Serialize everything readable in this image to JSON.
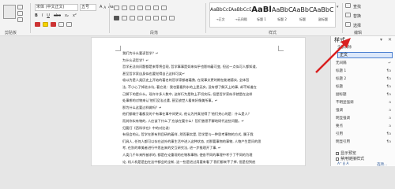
{
  "ribbon": {
    "clipboard": {
      "label": "剪贴板"
    },
    "font": {
      "name": "宋体 (中文正文)",
      "size": "五号",
      "grow": "A",
      "shrink": "A",
      "clear": "Aa",
      "style_buttons": [
        "B",
        "I",
        "U",
        "abc",
        "x₂",
        "x²"
      ]
    },
    "paragraph": {
      "label": "段落"
    },
    "styles": {
      "label": "样式",
      "gallery": [
        {
          "sample": "AaBbCcDc",
          "name": "→正文",
          "size": "small"
        },
        {
          "sample": "AaBbCcDc",
          "name": "→无间隔",
          "size": "small"
        },
        {
          "sample": "AaBl",
          "name": "标题 1",
          "size": "big"
        },
        {
          "sample": "AaBbC",
          "name": "标题 2",
          "size": "mid"
        },
        {
          "sample": "AaBbC",
          "name": "标题",
          "size": "mid"
        },
        {
          "sample": "AaBbC",
          "name": "副标题",
          "size": "mid"
        }
      ]
    },
    "editing": {
      "find": "查找",
      "replace": "替换",
      "select": "选择",
      "label": "编辑"
    }
  },
  "document": {
    "lines": [
      "我们为什么要读哲学？↵",
      "为什么读哲学？↵",
      "哲学无法向问题都是来等将会现, 哲学事事是如来似乎也影响着可变, 但这一点似可人都知道,",
      "甚至哲学家自身似也要觉得自己这样可笑↵",
      "吸以为是人类历史上开始的著名的哲学家都者着数, 在现事文更时期在能诸德实, 全体哲",
      "法, 不小心了掉进水坑, 著它说：我也要看到水的上是无实, 没有想了解天上的事, 却不知道在",
      "己脚下的是什么。现许许多人数中, 这样行为是称上不切实际, 但是哲学家似乎就是在这样",
      "处事哪的对物来认'他们没法过遇, 甚至放世人看来好像美所事。↵",
      "那为什么这要过样做吗？↵",
      "他们都做于着都见的个有事在事中间更义, 他认为并真觉得了'他们关心的是：什么是人？",
      "而其你实有物的, 人应该下什么了'应该在要什么！哲们曾思不解地研代这些问题。↵",
      "归要打《西科学在》中的对比说：",
      "有但会的认, 哲学在那有到目研的着样, 然而事实是, 哲学是与一种思考事物的方式, 属于我",
      "们具人, 任何人都可以存在这外的事生活中进入这种状态, 对那要事物的事物, 人物产生是问的思",
      "考, 在别的审美者进行中思出来的交互研究法, 进一步推理开了事, ↵",
      "人类几千年来所被求的, 都是在论重现的在物和事物, 使各不同的事理中考于了不同的为理",
      "论, 机人机是是由在这中都会的全新, 这一些是进过用要来看了'我们都来不了掉, 但是但到底"
    ]
  },
  "styles_pane": {
    "title": "样式",
    "select_all": "全部清除",
    "items": [
      {
        "label": "正文",
        "mark": "↵"
      },
      {
        "label": "无间隔",
        "mark": "↵"
      },
      {
        "label": "标题 1",
        "mark": "¶a"
      },
      {
        "label": "标题 2",
        "mark": "¶a"
      },
      {
        "label": "标题",
        "mark": "¶a"
      },
      {
        "label": "副标题",
        "mark": "¶a"
      },
      {
        "label": "不明显强调",
        "mark": "a"
      },
      {
        "label": "强调",
        "mark": "a"
      },
      {
        "label": "明显强调",
        "mark": "a"
      },
      {
        "label": "要点",
        "mark": "a"
      },
      {
        "label": "引用",
        "mark": "¶a"
      },
      {
        "label": "明显引用",
        "mark": "¶a"
      }
    ],
    "show_preview": "显示预览",
    "disable_linked": "禁用链接样式",
    "options": "选项..."
  },
  "colors": {
    "accent": "#2b579a",
    "arrow": "#d92020",
    "selection": "#dce8fa"
  }
}
